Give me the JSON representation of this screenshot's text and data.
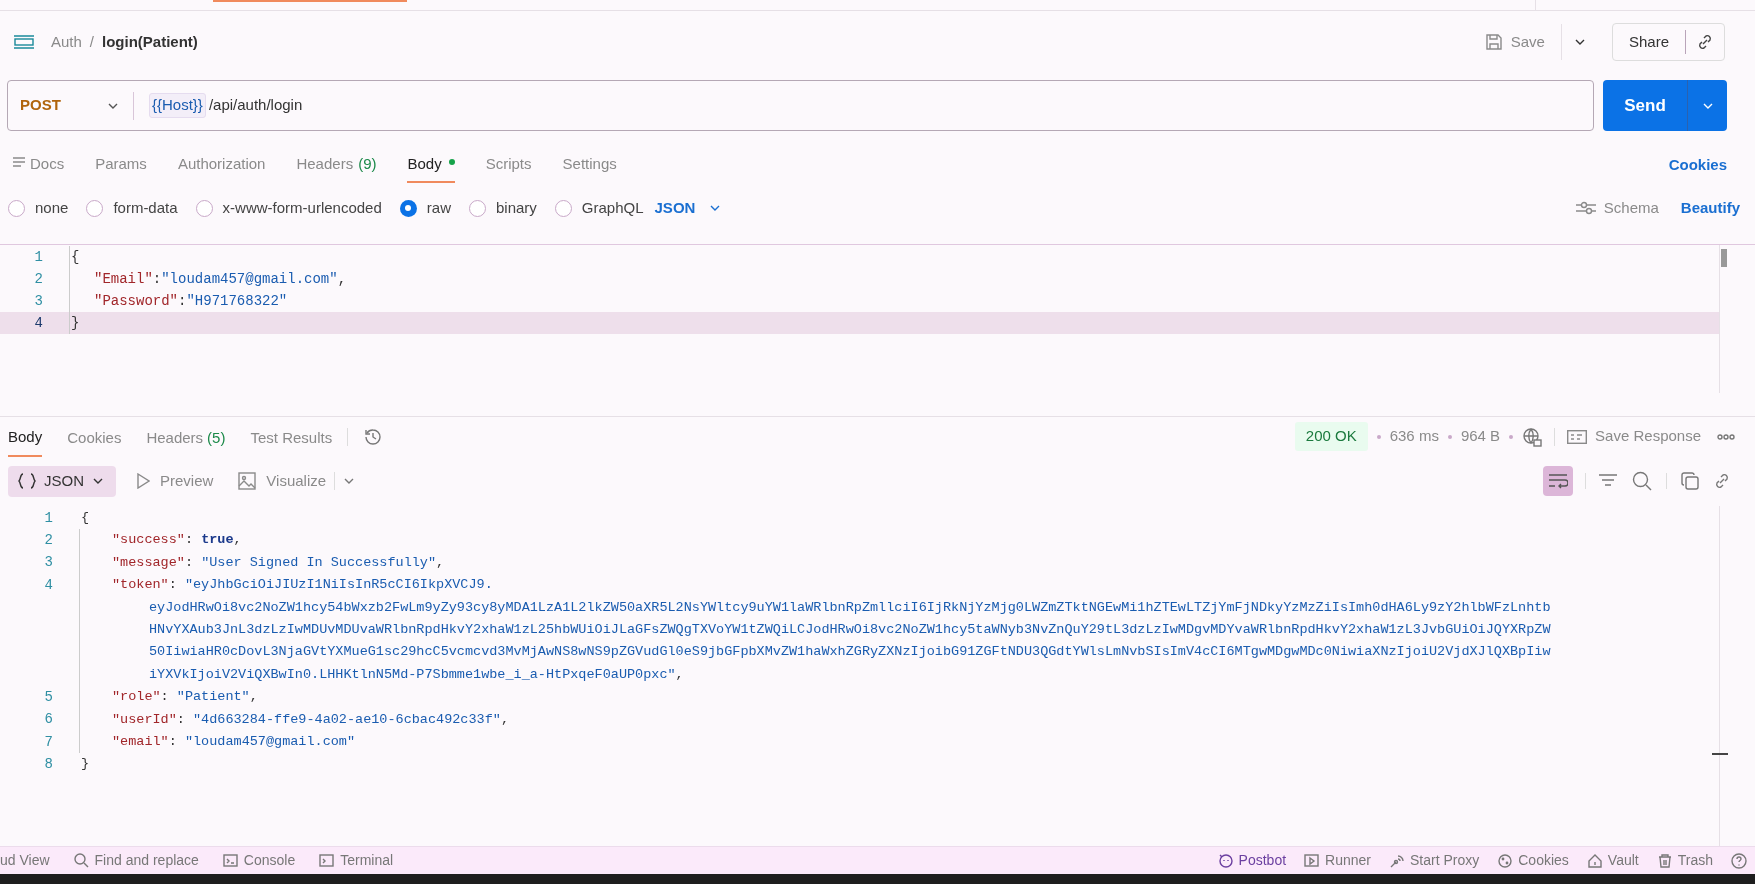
{
  "breadcrumb": {
    "parent": "Auth",
    "separator": "/",
    "current": "login(Patient)"
  },
  "header_actions": {
    "save": "Save",
    "share": "Share"
  },
  "request": {
    "method": "POST",
    "variable": "{{Host}}",
    "path": "/api/auth/login",
    "send": "Send"
  },
  "request_tabs": [
    {
      "label": "Docs",
      "dot": false,
      "selected": false,
      "kind": "docs"
    },
    {
      "label": "Params",
      "dot": false,
      "selected": false,
      "kind": "plain"
    },
    {
      "label": "Authorization",
      "dot": false,
      "selected": false,
      "kind": "plain"
    },
    {
      "label": "Headers",
      "count": "(9)",
      "dot": false,
      "selected": false,
      "kind": "plain"
    },
    {
      "label": "Body",
      "dot": true,
      "selected": true,
      "kind": "plain"
    },
    {
      "label": "Scripts",
      "dot": false,
      "selected": false,
      "kind": "plain"
    },
    {
      "label": "Settings",
      "dot": false,
      "selected": false,
      "kind": "plain"
    }
  ],
  "cookies_link": "Cookies",
  "body_types": [
    {
      "label": "none",
      "selected": false
    },
    {
      "label": "form-data",
      "selected": false
    },
    {
      "label": "x-www-form-urlencoded",
      "selected": false
    },
    {
      "label": "raw",
      "selected": true
    },
    {
      "label": "binary",
      "selected": false
    },
    {
      "label": "GraphQL",
      "selected": false
    }
  ],
  "body_format": "JSON",
  "schema": "Schema",
  "beautify": "Beautify",
  "request_body": [
    {
      "number": "1",
      "current": false,
      "parts": [
        {
          "kind": "punct",
          "text": "{"
        }
      ]
    },
    {
      "number": "2",
      "current": false,
      "indent": true,
      "parts": [
        {
          "kind": "key",
          "text": "\"Email\""
        },
        {
          "kind": "punct",
          "text": ":"
        },
        {
          "kind": "string",
          "text": "\"loudam457@gmail.com\""
        },
        {
          "kind": "punct",
          "text": ","
        }
      ]
    },
    {
      "number": "3",
      "current": false,
      "indent": true,
      "parts": [
        {
          "kind": "key",
          "text": "\"Password\""
        },
        {
          "kind": "punct",
          "text": ":"
        },
        {
          "kind": "string",
          "text": "\"H971768322\""
        }
      ]
    },
    {
      "number": "4",
      "current": true,
      "parts": [
        {
          "kind": "punct",
          "text": "}"
        }
      ]
    }
  ],
  "response_tabs": [
    {
      "label": "Body",
      "selected": true
    },
    {
      "label": "Cookies",
      "selected": false
    },
    {
      "label": "Headers",
      "count": "(5)",
      "selected": false
    },
    {
      "label": "Test Results",
      "selected": false
    }
  ],
  "response_status": {
    "code": "200 OK",
    "time": "636 ms",
    "size": "964 B",
    "save_response": "Save Response"
  },
  "response_view": {
    "format": "JSON",
    "preview": "Preview",
    "visualize": "Visualize",
    "wrap_on": true
  },
  "response_body": [
    {
      "number": "1",
      "parts": [
        {
          "kind": "punct",
          "text": "{"
        }
      ]
    },
    {
      "number": "2",
      "indent": true,
      "parts": [
        {
          "kind": "key",
          "text": "\"success\""
        },
        {
          "kind": "punct",
          "text": ": "
        },
        {
          "kind": "bool",
          "text": "true"
        },
        {
          "kind": "punct",
          "text": ","
        }
      ]
    },
    {
      "number": "3",
      "indent": true,
      "parts": [
        {
          "kind": "key",
          "text": "\"message\""
        },
        {
          "kind": "punct",
          "text": ": "
        },
        {
          "kind": "string",
          "text": "\"User Signed In Successfully\""
        },
        {
          "kind": "punct",
          "text": ","
        }
      ]
    },
    {
      "number": "4",
      "indent": true,
      "parts": [
        {
          "kind": "key",
          "text": "\"token\""
        },
        {
          "kind": "punct",
          "text": ": "
        },
        {
          "kind": "string",
          "text": "\"eyJhbGciOiJIUzI1NiIsInR5cCI6IkpXVCJ9."
        }
      ],
      "wrapped": [
        [
          {
            "kind": "string",
            "text": "eyJodHRwOi8vc2NoZW1hcy54bWxzb2FwLm9yZy93cy8yMDA1LzA1L2lkZW50aXR5L2NsYWltcy9uYW1laWRlbnRpZmllciI6IjRkNjYzMjg0LWZmZTktNGEwMi1hZTEwLTZjYmFjNDkyYzMzZiIsImh0dHA6Ly9zY2hlbWFzLnhtb"
          }
        ],
        [
          {
            "kind": "string",
            "text": "HNvYXAub3JnL3dzLzIwMDUvMDUvaWRlbnRpdHkvY2xhaW1zL25hbWUiOiJLaGFsZWQgTXVoYW1tZWQiLCJodHRwOi8vc2NoZW1hcy5taWNyb3NvZnQuY29tL3dzLzIwMDgvMDYvaWRlbnRpdHkvY2xhaW1zL3JvbGUiOiJQYXRpZW"
          }
        ],
        [
          {
            "kind": "string",
            "text": "50IiwiaHR0cDovL3NjaGVtYXMueG1sc29hcC5vcmcvd3MvMjAwNS8wNS9pZGVudGl0eS9jbGFpbXMvZW1haWxhZGRyZXNzIjoibG91ZGFtNDU3QGdtYWlsLmNvbSIsImV4cCI6MTgwMDgwMDc0NiwiaXNzIjoiU2VjdXJlQXBpIiw"
          }
        ],
        [
          {
            "kind": "string",
            "text": "iYXVkIjoiV2ViQXBwIn0.LHHKtlnN5Md-P7Sbmme1wbe_i_a-HtPxqeF0aUP0pxc\""
          },
          {
            "kind": "punct",
            "text": ","
          }
        ]
      ]
    },
    {
      "number": "5",
      "indent": true,
      "parts": [
        {
          "kind": "key",
          "text": "\"role\""
        },
        {
          "kind": "punct",
          "text": ": "
        },
        {
          "kind": "string",
          "text": "\"Patient\""
        },
        {
          "kind": "punct",
          "text": ","
        }
      ]
    },
    {
      "number": "6",
      "indent": true,
      "parts": [
        {
          "kind": "key",
          "text": "\"userId\""
        },
        {
          "kind": "punct",
          "text": ": "
        },
        {
          "kind": "string",
          "text": "\"4d663284-ffe9-4a02-ae10-6cbac492c33f\""
        },
        {
          "kind": "punct",
          "text": ","
        }
      ]
    },
    {
      "number": "7",
      "indent": true,
      "parts": [
        {
          "kind": "key",
          "text": "\"email\""
        },
        {
          "kind": "punct",
          "text": ": "
        },
        {
          "kind": "string",
          "text": "\"loudam457@gmail.com\""
        }
      ]
    },
    {
      "number": "8",
      "parts": [
        {
          "kind": "punct",
          "text": "}"
        }
      ]
    }
  ],
  "status_bar": {
    "left": [
      {
        "label": "ud View",
        "kind": "none"
      },
      {
        "label": "Find and replace",
        "kind": "search"
      },
      {
        "label": "Console",
        "kind": "console"
      },
      {
        "label": "Terminal",
        "kind": "terminal"
      }
    ],
    "right": [
      {
        "label": "Postbot",
        "kind": "bot"
      },
      {
        "label": "Runner",
        "kind": "runner"
      },
      {
        "label": "Start Proxy",
        "kind": "proxy"
      },
      {
        "label": "Cookies",
        "kind": "cookie"
      },
      {
        "label": "Vault",
        "kind": "vault"
      },
      {
        "label": "Trash",
        "kind": "trash"
      }
    ]
  }
}
